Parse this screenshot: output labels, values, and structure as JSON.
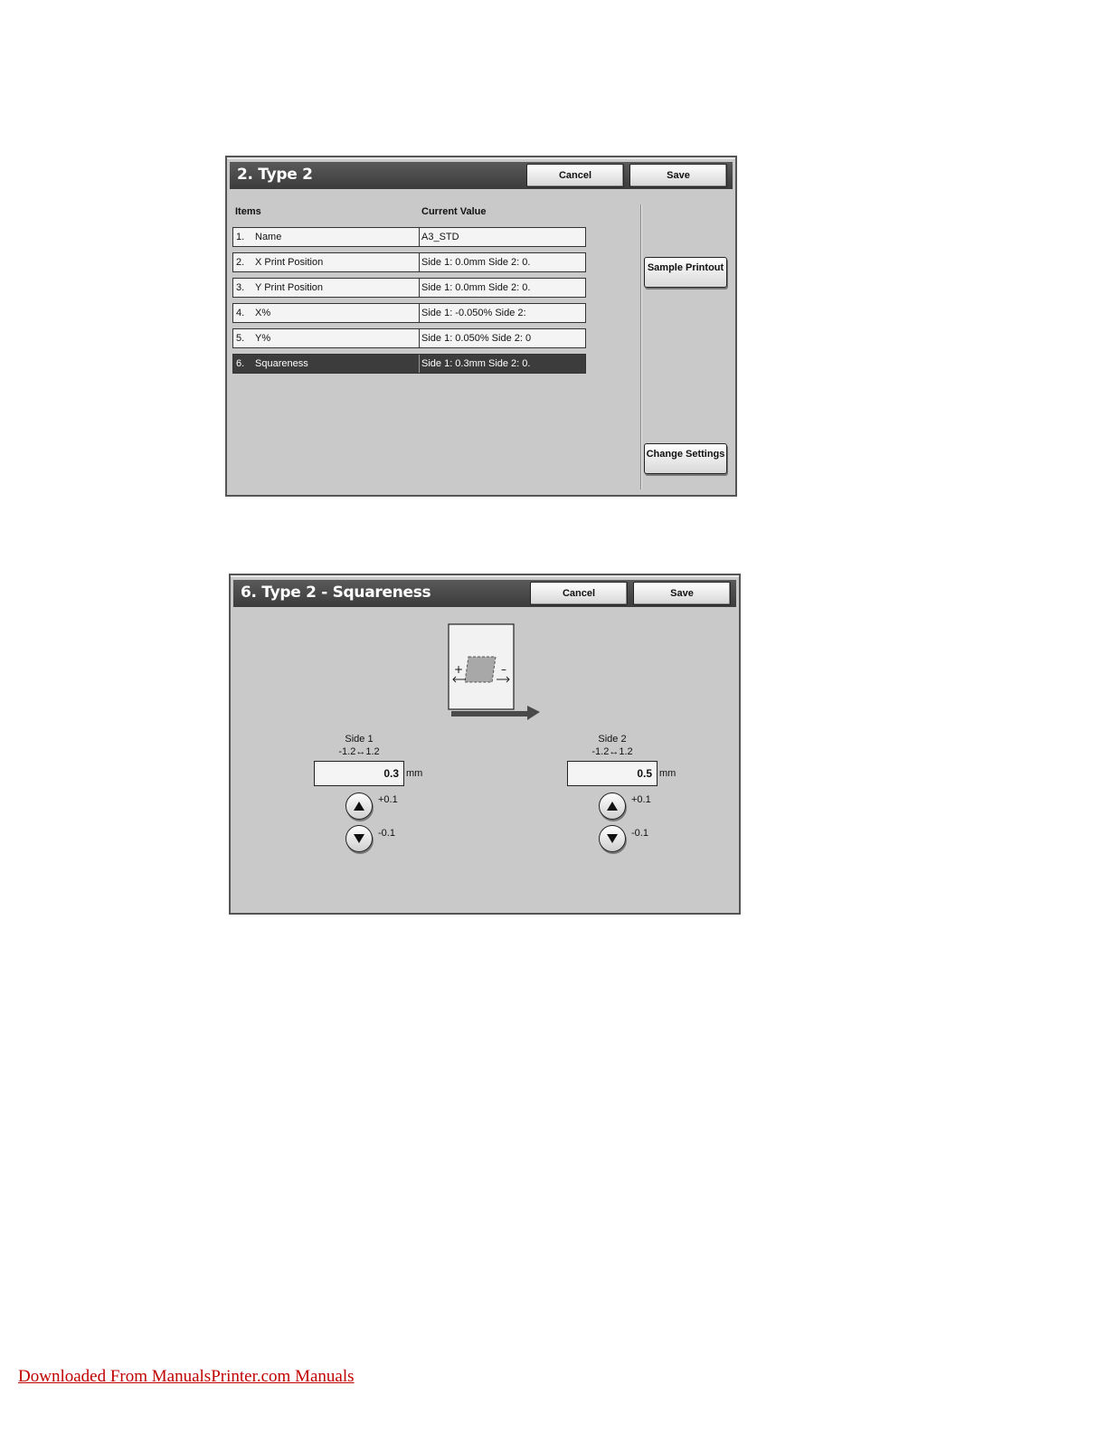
{
  "screen1": {
    "title": "2. Type 2",
    "cancel_label": "Cancel",
    "save_label": "Save",
    "col_items": "Items",
    "col_value": "Current Value",
    "rows": [
      {
        "num": "1.",
        "label": "Name",
        "value": "A3_STD"
      },
      {
        "num": "2.",
        "label": "X Print Position",
        "value": "Side 1: 0.0mm Side 2: 0."
      },
      {
        "num": "3.",
        "label": "Y Print Position",
        "value": "Side 1: 0.0mm Side 2: 0."
      },
      {
        "num": "4.",
        "label": "X%",
        "value": "Side 1: -0.050% Side 2:"
      },
      {
        "num": "5.",
        "label": "Y%",
        "value": "Side 1: 0.050% Side 2: 0"
      },
      {
        "num": "6.",
        "label": "Squareness",
        "value": "Side 1: 0.3mm Side 2: 0."
      }
    ],
    "selected_row": "6.",
    "sample_printout_label": "Sample Printout",
    "change_settings_label": "Change Settings"
  },
  "screen2": {
    "title": "6. Type 2 - Squareness",
    "cancel_label": "Cancel",
    "save_label": "Save",
    "diagram": {
      "plus": "+",
      "minus": "–"
    },
    "side1": {
      "label": "Side 1",
      "range": "-1.2↔1.2",
      "value": "0.3",
      "unit": "mm",
      "inc_label": "+0.1",
      "dec_label": "-0.1"
    },
    "side2": {
      "label": "Side 2",
      "range": "-1.2↔1.2",
      "value": "0.5",
      "unit": "mm",
      "inc_label": "+0.1",
      "dec_label": "-0.1"
    }
  },
  "footer": {
    "link_text": "Downloaded From ManualsPrinter.com Manuals"
  },
  "colors": {
    "panel": "#c9c9c9",
    "titlebar": "#3c3c3c",
    "selected_row": "#3c3c3c",
    "footer_link": "#c00000"
  }
}
